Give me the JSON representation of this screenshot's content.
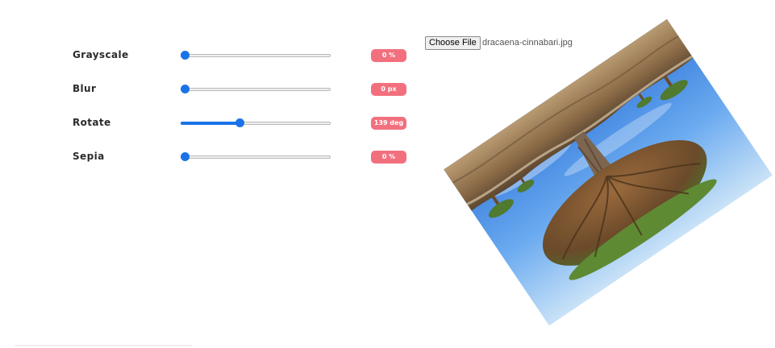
{
  "filters": [
    {
      "id": "grayscale",
      "label": "Grayscale",
      "value_text": "0 %",
      "level": 0
    },
    {
      "id": "blur",
      "label": "Blur",
      "value_text": "0 px",
      "level": 0
    },
    {
      "id": "rotate",
      "label": "Rotate",
      "value_text": "139 deg",
      "level": 0.39
    },
    {
      "id": "sepia",
      "label": "Sepia",
      "value_text": "0 %",
      "level": 0
    }
  ],
  "file_input": {
    "button_label": "Choose File",
    "file_name": "dracaena-cinnabari.jpg"
  },
  "colors": {
    "accent": "#1a73e8",
    "badge": "#f2707e"
  },
  "preview": {
    "icon": "dragon-blood-tree-photo"
  }
}
